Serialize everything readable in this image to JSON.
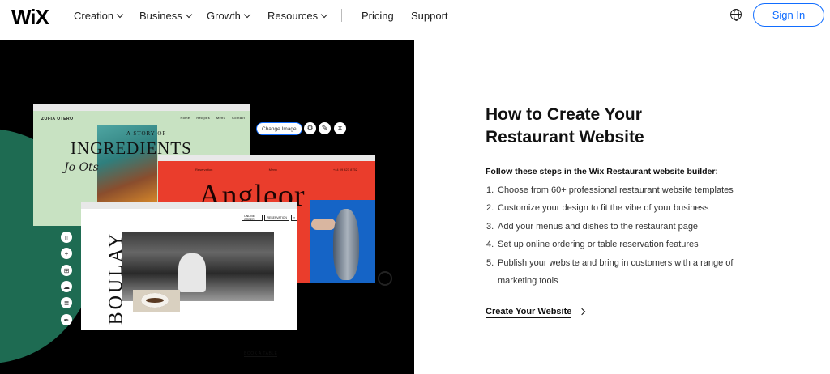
{
  "nav": {
    "logo": "WiX",
    "items": [
      "Creation",
      "Business",
      "Growth",
      "Resources"
    ],
    "pricing": "Pricing",
    "support": "Support",
    "signin": "Sign In"
  },
  "hero": {
    "card1": {
      "brand": "ZOFIA OTERO",
      "menu": [
        "Home",
        "Recipes",
        "Menu",
        "Contact"
      ],
      "story": "A STORY OF",
      "title": "INGREDIENTS",
      "signature": "Jo Ots"
    },
    "toolbar": {
      "change_image": "Change Image"
    },
    "card2": {
      "menu": [
        "Reservation",
        "Menu",
        "+44 09 423 8752"
      ],
      "title": "Angleor"
    },
    "card3": {
      "buttons": [
        "ONLINE ORDER",
        "RESERVATION"
      ],
      "title": "BOULAY",
      "book": "BOOK A TABLE"
    }
  },
  "content": {
    "heading": "How to Create Your Restaurant Website",
    "lead": "Follow these steps in the Wix Restaurant website builder:",
    "steps": [
      {
        "num": "1.",
        "text": "Choose from 60+ professional restaurant website templates"
      },
      {
        "num": "2.",
        "text": "Customize your design to fit the vibe of your business"
      },
      {
        "num": "3.",
        "text": "Add your menus and dishes to the restaurant page"
      },
      {
        "num": "4.",
        "text": "Set up online ordering or table reservation features"
      },
      {
        "num": "5.",
        "text": "Publish your website and bring in customers with a range of"
      },
      {
        "num": "",
        "text": "marketing tools"
      }
    ],
    "cta": "Create Your Website"
  },
  "colors": {
    "accent": "#116dff",
    "hero_bg": "#000000",
    "green": "#1e6b52",
    "red": "#ea3d2c",
    "mint": "#c8e2c2"
  }
}
